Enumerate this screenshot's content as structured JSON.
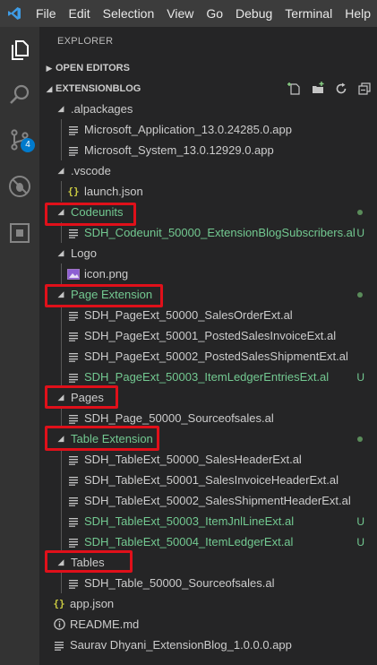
{
  "menu": [
    "File",
    "Edit",
    "Selection",
    "View",
    "Go",
    "Debug",
    "Terminal",
    "Help"
  ],
  "activity": {
    "scm_badge": "4"
  },
  "explorer": {
    "title": "EXPLORER",
    "open_editors": "OPEN EDITORS",
    "workspace": "EXTENSIONBLOG"
  },
  "tree": [
    {
      "label": ".alpackages",
      "type": "folder",
      "open": true,
      "depth": 1
    },
    {
      "label": "Microsoft_Application_13.0.24285.0.app",
      "type": "file",
      "depth": 2
    },
    {
      "label": "Microsoft_System_13.0.12929.0.app",
      "type": "file",
      "depth": 2
    },
    {
      "label": ".vscode",
      "type": "folder",
      "open": true,
      "depth": 1
    },
    {
      "label": "launch.json",
      "type": "json",
      "depth": 2
    },
    {
      "label": "Codeunits",
      "type": "folder",
      "open": true,
      "depth": 1,
      "modified": true,
      "dot": true
    },
    {
      "label": "SDH_Codeunit_50000_ExtensionBlogSubscribers.al",
      "type": "file",
      "depth": 2,
      "modified": true,
      "status": "U"
    },
    {
      "label": "Logo",
      "type": "folder",
      "open": true,
      "depth": 1
    },
    {
      "label": "icon.png",
      "type": "image",
      "depth": 2
    },
    {
      "label": "Page Extension",
      "type": "folder",
      "open": true,
      "depth": 1,
      "modified": true,
      "dot": true
    },
    {
      "label": "SDH_PageExt_50000_SalesOrderExt.al",
      "type": "file",
      "depth": 2
    },
    {
      "label": "SDH_PageExt_50001_PostedSalesInvoiceExt.al",
      "type": "file",
      "depth": 2
    },
    {
      "label": "SDH_PageExt_50002_PostedSalesShipmentExt.al",
      "type": "file",
      "depth": 2
    },
    {
      "label": "SDH_PageExt_50003_ItemLedgerEntriesExt.al",
      "type": "file",
      "depth": 2,
      "modified": true,
      "status": "U"
    },
    {
      "label": "Pages",
      "type": "folder",
      "open": true,
      "depth": 1
    },
    {
      "label": "SDH_Page_50000_Sourceofsales.al",
      "type": "file",
      "depth": 2
    },
    {
      "label": "Table Extension",
      "type": "folder",
      "open": true,
      "depth": 1,
      "modified": true,
      "dot": true
    },
    {
      "label": "SDH_TableExt_50000_SalesHeaderExt.al",
      "type": "file",
      "depth": 2
    },
    {
      "label": "SDH_TableExt_50001_SalesInvoiceHeaderExt.al",
      "type": "file",
      "depth": 2
    },
    {
      "label": "SDH_TableExt_50002_SalesShipmentHeaderExt.al",
      "type": "file",
      "depth": 2
    },
    {
      "label": "SDH_TableExt_50003_ItemJnlLineExt.al",
      "type": "file",
      "depth": 2,
      "modified": true,
      "status": "U"
    },
    {
      "label": "SDH_TableExt_50004_ItemLedgerExt.al",
      "type": "file",
      "depth": 2,
      "modified": true,
      "status": "U"
    },
    {
      "label": "Tables",
      "type": "folder",
      "open": true,
      "depth": 1
    },
    {
      "label": "SDH_Table_50000_Sourceofsales.al",
      "type": "file",
      "depth": 2
    },
    {
      "label": "app.json",
      "type": "json",
      "depth": 0
    },
    {
      "label": "README.md",
      "type": "info",
      "depth": 0
    },
    {
      "label": "Saurav Dhyani_ExtensionBlog_1.0.0.0.app",
      "type": "file",
      "depth": 0
    }
  ],
  "colors": {
    "modified": "#73c991",
    "highlight_box": "#e0101a",
    "badge": "#007acc"
  }
}
